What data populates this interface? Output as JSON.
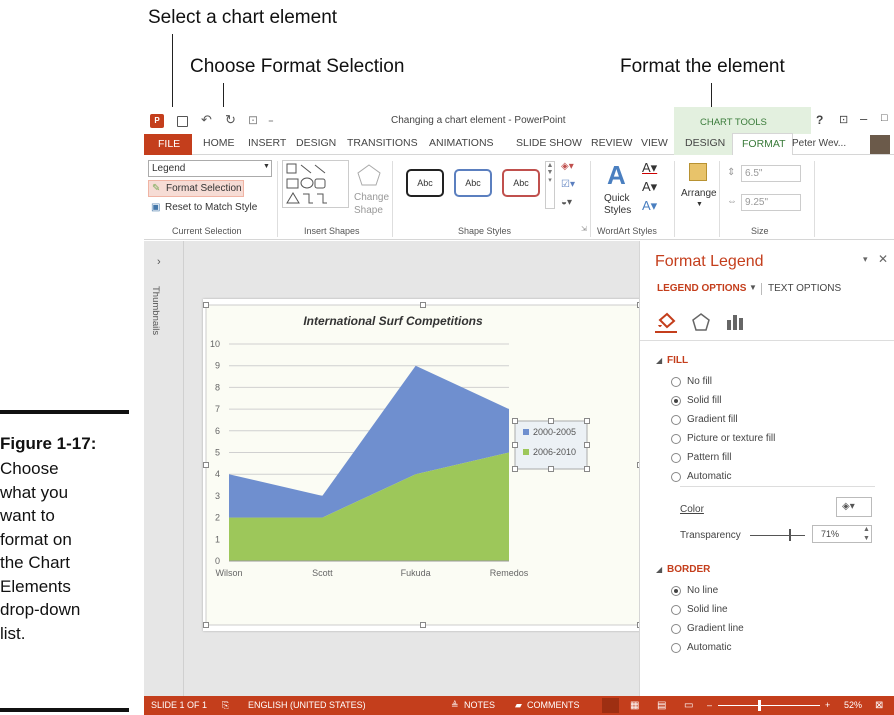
{
  "callouts": {
    "select": "Select a chart element",
    "choose": "Choose Format Selection",
    "format": "Format the element"
  },
  "figure": {
    "label": "Figure 1-17:",
    "caption_lines": [
      "Choose",
      "what you",
      "want to",
      "format on",
      "the Chart",
      "Elements",
      "drop-down",
      "list."
    ]
  },
  "window": {
    "title": "Changing a chart element - PowerPoint",
    "context_tab_group": "CHART TOOLS",
    "user": "Peter Wev...",
    "help": "?"
  },
  "tabs": [
    "FILE",
    "HOME",
    "INSERT",
    "DESIGN",
    "TRANSITIONS",
    "ANIMATIONS",
    "SLIDE SHOW",
    "REVIEW",
    "VIEW",
    "DESIGN",
    "FORMAT"
  ],
  "ribbon": {
    "current_selection": {
      "dropdown_value": "Legend",
      "format_selection": "Format Selection",
      "reset": "Reset to Match Style",
      "label": "Current Selection"
    },
    "insert_shapes": {
      "change_shape": "Change",
      "change_shape2": "Shape",
      "label": "Insert Shapes"
    },
    "shape_styles": {
      "sample": "Abc",
      "label": "Shape Styles"
    },
    "wordart": {
      "quick": "Quick",
      "styles": "Styles",
      "label": "WordArt Styles"
    },
    "arrange": {
      "label": "Arrange"
    },
    "size": {
      "height": "6.5\"",
      "width": "9.25\"",
      "label": "Size"
    }
  },
  "thumbnails_label": "Thumbnails",
  "chart_data": {
    "type": "area",
    "title": "International Surf Competitions",
    "categories": [
      "Wilson",
      "Scott",
      "Fukuda",
      "Remedos"
    ],
    "series": [
      {
        "name": "2000-2005",
        "values": [
          2,
          1,
          5,
          2
        ],
        "color": "#6f8fcf"
      },
      {
        "name": "2006-2010",
        "values": [
          2,
          2,
          4,
          5
        ],
        "color": "#9dc75a"
      }
    ],
    "stacked": true,
    "ylim": [
      0,
      10
    ],
    "yticks": [
      "0",
      "1",
      "2",
      "3",
      "4",
      "5",
      "6",
      "7",
      "8",
      "9",
      "10"
    ],
    "legend": "right",
    "grid": true
  },
  "pane": {
    "title": "Format Legend",
    "tab_legend": "LEGEND OPTIONS",
    "tab_text": "TEXT OPTIONS",
    "fill_header": "FILL",
    "fill_options": [
      "No fill",
      "Solid fill",
      "Gradient fill",
      "Picture or texture fill",
      "Pattern fill",
      "Automatic"
    ],
    "fill_selected": "Solid fill",
    "color_label": "Color",
    "transparency_label": "Transparency",
    "transparency_value": "71%",
    "transparency_fraction": 0.71,
    "border_header": "BORDER",
    "border_options": [
      "No line",
      "Solid line",
      "Gradient line",
      "Automatic"
    ],
    "border_selected": "No line"
  },
  "status": {
    "slide": "SLIDE 1 OF 1",
    "language": "ENGLISH (UNITED STATES)",
    "notes": "NOTES",
    "comments": "COMMENTS",
    "zoom": "52%"
  },
  "colors": {
    "file_tab": "#c43e1c",
    "accent": "#c43e1c",
    "context": "#e3f0df"
  }
}
